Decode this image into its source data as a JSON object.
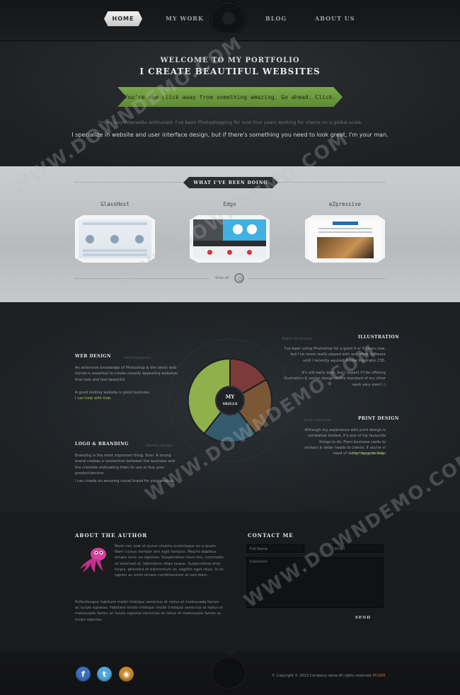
{
  "nav": {
    "items": [
      "HOME",
      "MY WORK",
      "BLOG",
      "ABOUT US"
    ],
    "active": "HOME"
  },
  "hero": {
    "title1": "WELCOME TO MY PORTFOLIO",
    "title2": "I CREATE BEAUTIFUL WEBSITES",
    "ribbon": "You're one click away from something amazing. Go ahead. Click.",
    "intro": "I'm a crazy interwebs enthusiast. I've been Photoshopping for over four years working for clients on a global scale.",
    "statement": "I specialize in website and user interface design, but if there's something you need to look great, I'm your man."
  },
  "work": {
    "banner": "WHAT I'VE BEEN DOING",
    "projects": [
      {
        "title": "GlassHost"
      },
      {
        "title": "Edge"
      },
      {
        "title": "eZpressive"
      }
    ],
    "view_all": "View all"
  },
  "skills": {
    "center_line1": "MY",
    "center_line2": "SKILLS",
    "web_design": {
      "title": "WEB DESIGN",
      "sub": "html/css/jquery",
      "text": "An extensive knowledge of Photoshop & the latest web trends is essential to create visually appealing websites that look and feel beautiful.",
      "text2": "A good looking website is good business.",
      "link": "I can help with that."
    },
    "logo": {
      "title": "LOGO & BRANDING",
      "sub": "identity design",
      "text": "Branding is the most important thing. Ever. A strong brand creates a connection between the business and the clientele motivating them to use or buy your product/service.",
      "text2": "I can create an amazing visual brand for your product."
    },
    "illustration": {
      "title": "ILLUSTRATION",
      "sub": "digital illustration",
      "text": "I've been using Photoshop for a good 4 or 5 years now, but I've never really played with any other software until I recently aquired Adobe Illustrator CS5.",
      "text2": "It's still early days, but I expect I'll be offering illustration & vector design to the standard of my other work very soon! ;)"
    },
    "print": {
      "title": "PRINT DESIGN",
      "sub": "print materials",
      "text": "Although my experience with print design is somewhat limited, it's one of my favourite things to do. From business cards to stickers & letter heads to clients. If you're in need of design for print then",
      "link": "I'm happy to help."
    },
    "colors": [
      "#8fb04a",
      "#7c3a38",
      "#7a5836",
      "#335a6d"
    ]
  },
  "footer": {
    "about_title": "ABOUT THE AUTHOR",
    "about_p1": "Nunc nec erat et purus viverra scelerisque eu a quam. Nam cursus semper orci eget tempus. Mauris dapibus ornare nunc eu egestas. Suspendisse risus nisi, commodo ut euismod ut, bibendum vitae neque. Suspendisse eros turpis, pharetra et elementum at, sagittis eget risus. In ac sapien ac enim ornare condimentum at sed diam.",
    "about_p2": "Pellentesque habitant morbi tristique senectus et netus et malesuada fames ac turpis egestas. Habitant morbi tristique morbi tristique senectus et netus et malesuada fames ac turpis egestas senectus et netus et malesuada fames ac turpis egestas.",
    "contact_title": "CONTACT ME",
    "fullname_placeholder": "Full Name",
    "email_placeholder": "Email",
    "comment_placeholder": "Comment",
    "send": "SEND"
  },
  "bottom": {
    "copyright": "© Copyright © 2013 Company name All rights reserved",
    "copyright_accent": "ATLERE"
  },
  "watermark": "WWW.DOWNDEMO.COM"
}
